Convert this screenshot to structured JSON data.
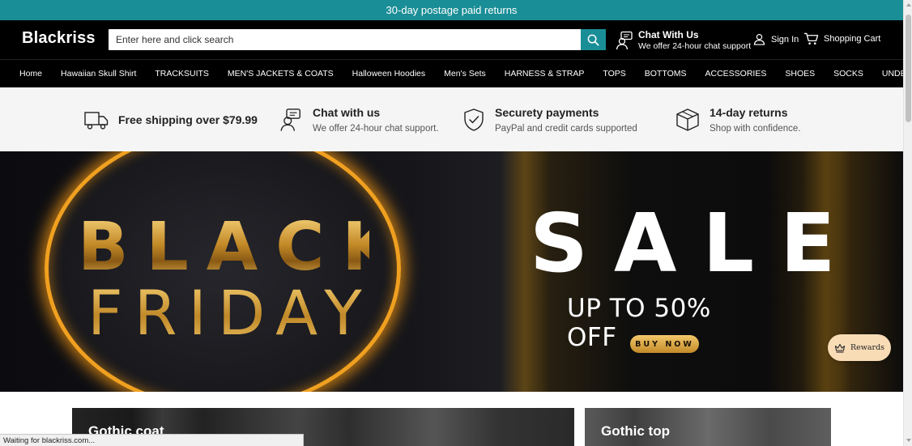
{
  "announcement": {
    "text": "30-day postage paid returns"
  },
  "header": {
    "logo": "Blackriss",
    "search_placeholder": "Enter here and click search",
    "chat_title": "Chat With Us",
    "chat_sub": "We offer 24-hour chat support",
    "signin": "Sign In",
    "cart": "Shopping Cart"
  },
  "nav": {
    "items": [
      "Home",
      "Hawaiian Skull Shirt",
      "TRACKSUITS",
      "MEN'S JACKETS & COATS",
      "Halloween Hoodies",
      "Men's Sets",
      "HARNESS & STRAP",
      "TOPS",
      "BOTTOMS",
      "ACCESSORIES",
      "SHOES",
      "SOCKS",
      "UNDERWEAR"
    ]
  },
  "features": [
    {
      "title": "Free shipping over $79.99",
      "sub": ""
    },
    {
      "title": "Chat with us",
      "sub": "We offer 24-hour chat support."
    },
    {
      "title": "Securety payments",
      "sub": "PayPal and credit cards supported"
    },
    {
      "title": "14-day returns",
      "sub": "Shop with confidence."
    }
  ],
  "banner": {
    "word1": "BLACK",
    "word2": "FRIDAY",
    "sale": "SALE",
    "offer": "UP TO 50% OFF",
    "cta": "BUY NOW"
  },
  "rewards": {
    "label": "Rewards"
  },
  "collections": [
    {
      "title": "Gothic coat"
    },
    {
      "title": "Gothic top"
    }
  ],
  "status": {
    "text": "Waiting for blackriss.com..."
  },
  "colors": {
    "accent": "#1a8e96",
    "header_bg": "#000000",
    "features_bg": "#f5f5f5",
    "gold": "#c9932e",
    "rewards_bg": "#f8dcb6"
  },
  "icons": {
    "search": "search-icon",
    "chat": "chat-support-icon",
    "user": "user-icon",
    "cart": "cart-icon",
    "truck": "truck-icon",
    "shield": "shield-check-icon",
    "box": "box-icon",
    "crown": "crown-icon"
  }
}
